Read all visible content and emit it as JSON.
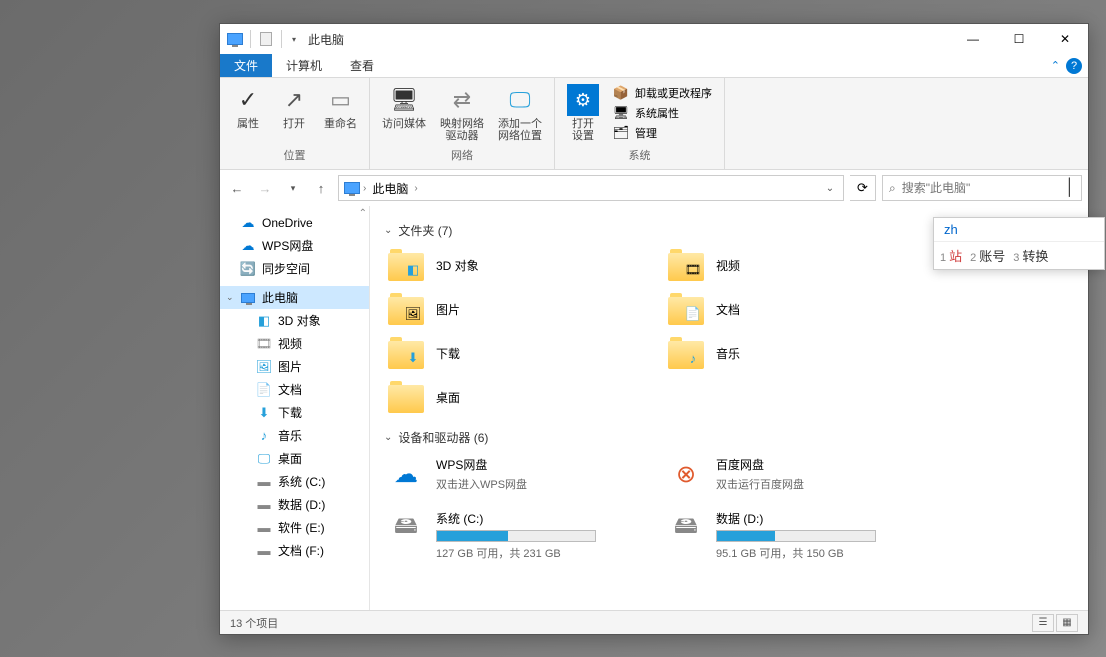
{
  "titlebar": {
    "title": "此电脑"
  },
  "win_controls": {
    "min": "—",
    "max": "☐",
    "close": "✕"
  },
  "tabs": {
    "file": "文件",
    "computer": "计算机",
    "view": "查看",
    "collapse": "⌃"
  },
  "ribbon": {
    "location": {
      "properties": "属性",
      "open": "打开",
      "rename": "重命名",
      "group": "位置"
    },
    "network": {
      "access_media": "访问媒体",
      "map_drive": "映射网络\n驱动器",
      "add_location": "添加一个\n网络位置",
      "group": "网络"
    },
    "system": {
      "open_settings": "打开\n设置",
      "uninstall": "卸载或更改程序",
      "system_props": "系统属性",
      "manage": "管理",
      "group": "系统"
    }
  },
  "addressbar": {
    "crumb1": "此电脑",
    "search_placeholder": "搜索\"此电脑\""
  },
  "navpane": {
    "onedrive": "OneDrive",
    "wps": "WPS网盘",
    "sync": "同步空间",
    "thispc": "此电脑",
    "children": {
      "3d": "3D 对象",
      "videos": "视频",
      "pictures": "图片",
      "documents": "文档",
      "downloads": "下载",
      "music": "音乐",
      "desktop": "桌面",
      "drive_c": "系统 (C:)",
      "drive_d": "数据 (D:)",
      "drive_e": "软件 (E:)",
      "drive_f": "文档 (F:)"
    }
  },
  "content": {
    "folders_header": "文件夹 (7)",
    "devices_header": "设备和驱动器 (6)",
    "folders": {
      "3d": "3D 对象",
      "videos": "视频",
      "pictures": "图片",
      "documents": "文档",
      "downloads": "下载",
      "music": "音乐",
      "desktop": "桌面"
    },
    "drives": {
      "wps": {
        "name": "WPS网盘",
        "sub": "双击进入WPS网盘"
      },
      "baidu": {
        "name": "百度网盘",
        "sub": "双击运行百度网盘"
      },
      "c": {
        "name": "系统 (C:)",
        "text": "127 GB 可用，共 231 GB",
        "fill": 45
      },
      "d": {
        "name": "数据 (D:)",
        "text": "95.1 GB 可用，共 150 GB",
        "fill": 37
      }
    }
  },
  "statusbar": {
    "count": "13 个项目"
  },
  "ime": {
    "composition": "zh",
    "candidates": [
      {
        "n": "1",
        "w": "站"
      },
      {
        "n": "2",
        "w": "账号"
      },
      {
        "n": "3",
        "w": "转换"
      }
    ]
  }
}
